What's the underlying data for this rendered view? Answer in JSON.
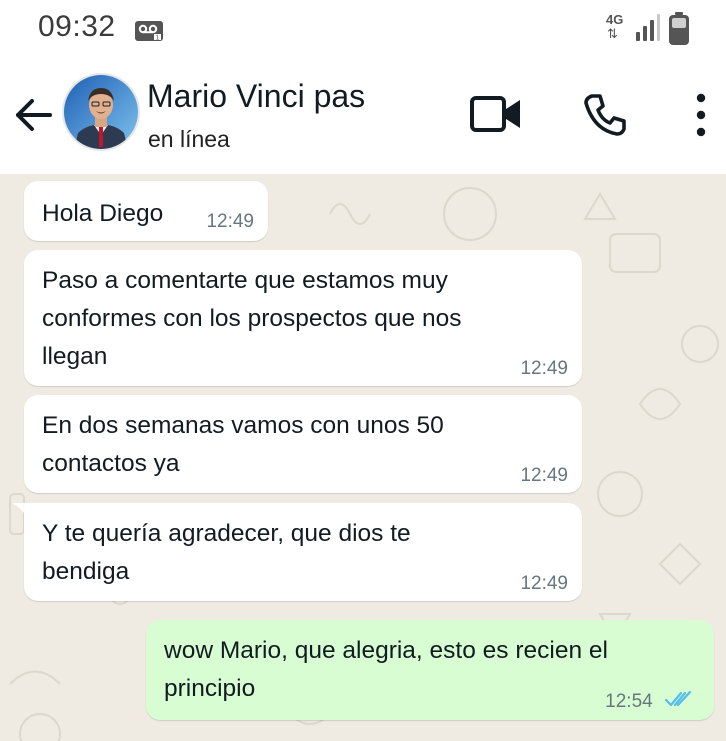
{
  "status_bar": {
    "time": "09:32",
    "network_type": "4G",
    "network_arrows": "⇅",
    "icons": [
      "voicemail-icon",
      "signal-icon",
      "battery-icon"
    ]
  },
  "header": {
    "contact_name": "Mario Vinci pas",
    "contact_status": "en línea",
    "icons": [
      "back-arrow-icon",
      "video-camera-icon",
      "phone-icon",
      "more-vert-icon"
    ]
  },
  "messages": [
    {
      "direction": "incoming",
      "text": "Hola Diego",
      "time": "12:49"
    },
    {
      "direction": "incoming",
      "text": "Paso a comentarte que estamos muy conformes con los prospectos que nos llegan",
      "time": "12:49"
    },
    {
      "direction": "incoming",
      "text": "En dos semanas vamos con unos 50 contactos ya",
      "time": "12:49"
    },
    {
      "direction": "incoming",
      "text": "Y te quería agradecer, que dios te bendiga",
      "time": "12:49"
    },
    {
      "direction": "outgoing",
      "text": "wow Mario, que alegria, esto es recien el principio",
      "time": "12:54",
      "read": true
    }
  ],
  "colors": {
    "chat_background": "#efeae2",
    "incoming_bubble": "#ffffff",
    "outgoing_bubble": "#d9fdd3",
    "read_ticks": "#53bdeb",
    "timestamp": "#667781"
  }
}
